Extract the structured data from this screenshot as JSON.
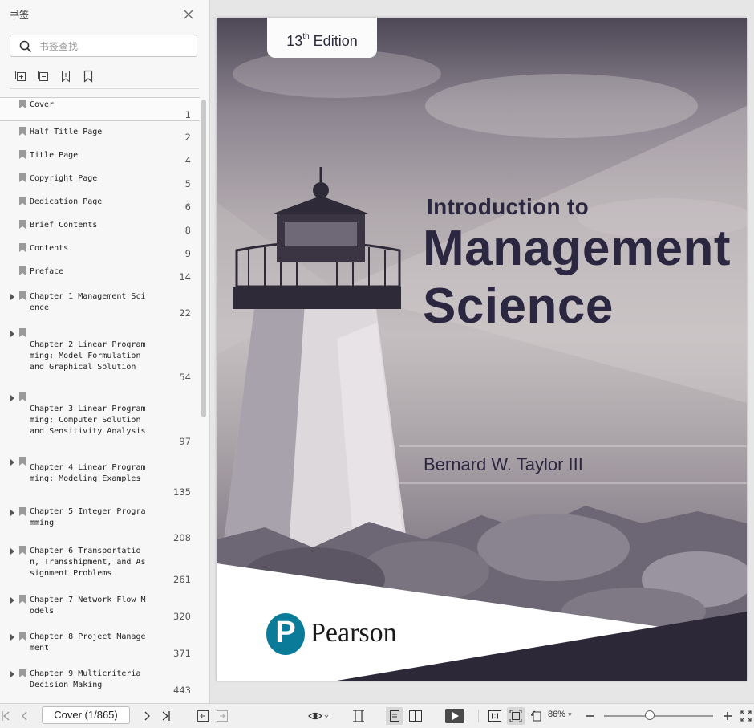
{
  "sidebar": {
    "title": "书签",
    "search_placeholder": "书签查找",
    "bookmarks": [
      {
        "label": "Cover",
        "page": "1"
      },
      {
        "label": "Half Title Page",
        "page": "2"
      },
      {
        "label": "Title Page",
        "page": "4"
      },
      {
        "label": "Copyright Page",
        "page": "5"
      },
      {
        "label": "Dedication Page",
        "page": "6"
      },
      {
        "label": "Brief Contents",
        "page": "8"
      },
      {
        "label": "Contents",
        "page": "9"
      },
      {
        "label": "Preface",
        "page": "14"
      },
      {
        "label": "Chapter 1 Management Science",
        "page": "22"
      },
      {
        "label": "Chapter 2 Linear Programming: Model Formulation and Graphical Solution",
        "page": "54"
      },
      {
        "label": "Chapter 3 Linear Programming: Computer Solution and Sensitivity Analysis",
        "page": "97"
      },
      {
        "label": "Chapter 4 Linear Programming: Modeling Examples",
        "page": "135"
      },
      {
        "label": "Chapter 5 Integer Programming",
        "page": "208"
      },
      {
        "label": "Chapter 6 Transportation, Transshipment, and Assignment Problems",
        "page": "261"
      },
      {
        "label": "Chapter 7 Network Flow Models",
        "page": "320"
      },
      {
        "label": "Chapter 8 Project Management",
        "page": "371"
      },
      {
        "label": "Chapter 9 Multicriteria Decision Making",
        "page": "443"
      }
    ]
  },
  "cover": {
    "edition_num": "13",
    "edition_sup": "th",
    "edition_word": "Edition",
    "title_line1": "Introduction to",
    "title_line2": "Management",
    "title_line3": "Science",
    "author": "Bernard W. Taylor III",
    "publisher_mark": "P",
    "publisher": "Pearson"
  },
  "toolbar": {
    "page_indicator": "Cover (1/865)",
    "zoom": "86%",
    "zoom_level": 0.43
  },
  "icons": {
    "search": "search-icon",
    "close": "close-icon",
    "expand_all": "expand-all-icon",
    "collapse_all": "collapse-all-icon",
    "add_bookmark": "add-bookmark-icon",
    "bookmark": "bookmark-icon",
    "first_page": "first-page-icon",
    "prev_page": "prev-page-icon",
    "next_page": "next-page-icon",
    "last_page": "last-page-icon",
    "back": "back-icon",
    "forward": "forward-icon",
    "read_mode": "eye-icon",
    "fit_width": "fit-width-icon",
    "single_page": "single-page-icon",
    "two_page": "two-page-icon",
    "slideshow": "play-icon",
    "actual_size": "actual-size-icon",
    "fit_page": "fit-page-icon",
    "rotate": "rotate-icon",
    "zoom_out": "zoom-out-icon",
    "zoom_in": "zoom-in-icon",
    "fullscreen": "fullscreen-icon"
  }
}
